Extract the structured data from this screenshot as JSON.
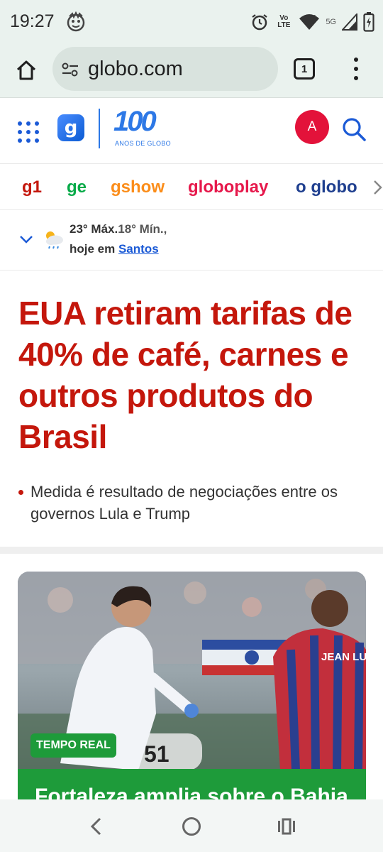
{
  "status_bar": {
    "time": "19:27",
    "volte_label": "Vo\nLTE",
    "network": "5G",
    "icons": [
      "face-notification-icon",
      "alarm-icon",
      "volte-icon",
      "wifi-icon",
      "signal-icon",
      "battery-icon"
    ]
  },
  "browser": {
    "url": "globo.com",
    "tab_count": "1",
    "icons": [
      "home-icon",
      "site-settings-icon",
      "tabs-icon",
      "more-vert-icon"
    ]
  },
  "site_header": {
    "brand_logo_letter": "g",
    "anniversary_number": "100",
    "anniversary_text": "ANOS DE GLOBO",
    "avatar_letter": "A",
    "brand_color": "#2d78e6",
    "avatar_color": "#e3123a"
  },
  "brand_nav": {
    "items": [
      {
        "label": "g1",
        "color": "#c4170c"
      },
      {
        "label": "ge",
        "color": "#06aa48"
      },
      {
        "label": "gshow",
        "color": "#fb8d1a"
      },
      {
        "label": "globoplay",
        "color": "#e6184b"
      },
      {
        "label": "o globo",
        "color": "#1f3f8f"
      }
    ]
  },
  "weather": {
    "max": "23° Máx.",
    "min": "18° Mín.,",
    "today_prefix": "hoje em ",
    "city": "Santos",
    "icon": "cloud-rain-sun-icon"
  },
  "headline": {
    "title": "EUA retiram tarifas de 40% de café, carnes e outros produtos do Brasil",
    "bullet": "Medida é resultado de negociações entre os governos Lula e Trump",
    "color": "#c4170c"
  },
  "card": {
    "badge": "TEMPO REAL",
    "title": "Fortaleza amplia sobre o Bahia",
    "badge_color": "#1e9b3a"
  },
  "android_nav": {
    "icons": [
      "back-icon",
      "home-circle-icon",
      "recent-apps-icon"
    ]
  }
}
